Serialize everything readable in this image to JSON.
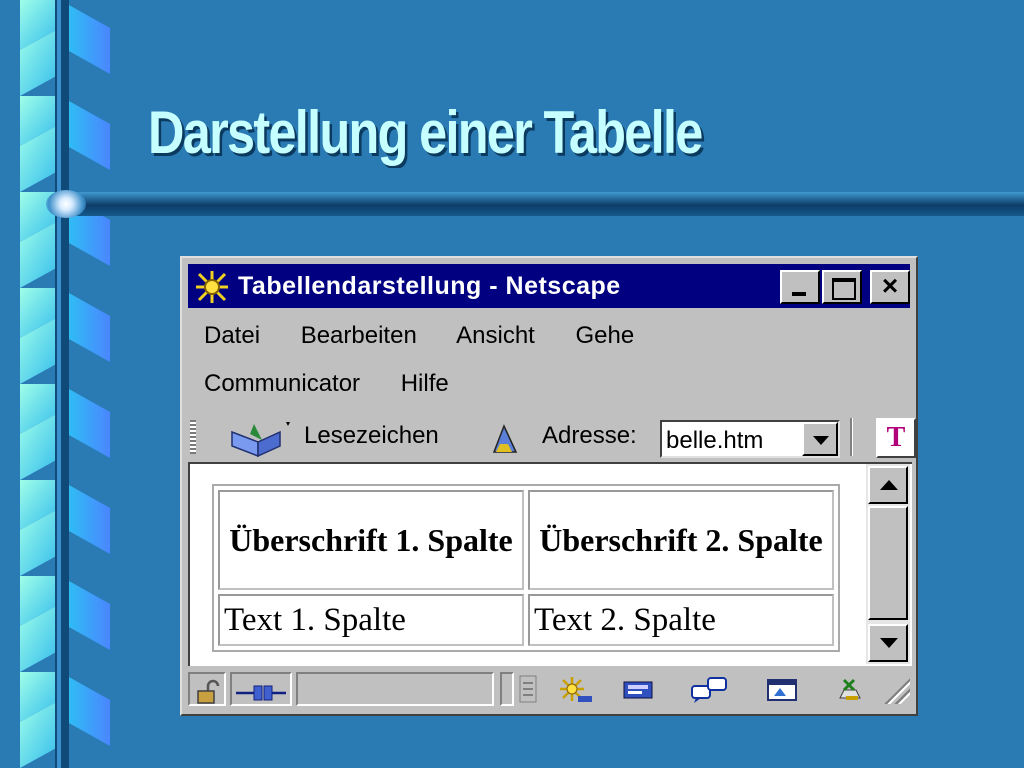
{
  "slide": {
    "title": "Darstellung einer Tabelle"
  },
  "window": {
    "title": "Tabellendarstellung - Netscape",
    "controls": {
      "minimize": "_",
      "maximize": "□",
      "close": "×"
    }
  },
  "menu": {
    "row1": [
      "Datei",
      "Bearbeiten",
      "Ansicht",
      "Gehe"
    ],
    "row2": [
      "Communicator",
      "Hilfe"
    ]
  },
  "toolbar": {
    "bookmarks_label": "Lesezeichen",
    "address_label": "Adresse:",
    "address_value": "belle.htm",
    "t_button": "T"
  },
  "page_table": {
    "headers": [
      "Überschrift 1. Spalte",
      "Überschrift 2. Spalte"
    ],
    "rows": [
      [
        "Text 1. Spalte",
        "Text 2. Spalte"
      ]
    ]
  },
  "icons": {
    "app": "netscape-star-icon",
    "bookmarks": "bookmarks-icon",
    "site": "what-is-related-icon",
    "status": [
      "security-lock-icon",
      "connection-plug-icon",
      "navigator-icon",
      "mail-icon",
      "discussion-icon",
      "composer-icon",
      "instant-message-icon"
    ]
  },
  "colors": {
    "slide_background": "#2a7ab4",
    "title_text": "#c6ffff",
    "titlebar": "#000080",
    "window_chrome": "#c0c0c0"
  }
}
